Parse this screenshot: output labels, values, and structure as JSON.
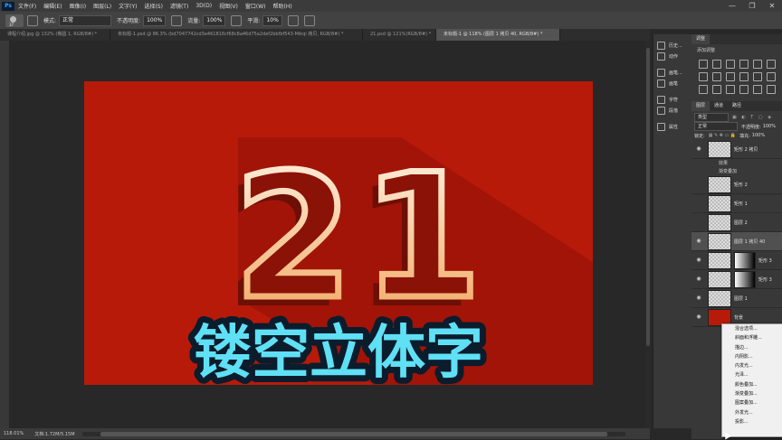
{
  "menubar": {
    "app_icon": "Ps",
    "items": [
      "文件(F)",
      "编辑(E)",
      "图像(I)",
      "图层(L)",
      "文字(Y)",
      "选择(S)",
      "滤镜(T)",
      "3D(D)",
      "视图(V)",
      "窗口(W)",
      "帮助(H)"
    ],
    "window_controls": [
      "—",
      "❐",
      "✕"
    ]
  },
  "options": {
    "brush_size": "37",
    "mode_label": "模式:",
    "mode_value": "正常",
    "opacity_label": "不透明度:",
    "opacity_value": "100%",
    "flow_label": "流量:",
    "flow_value": "100%",
    "smooth_label": "平滑:",
    "smooth_value": "10%"
  },
  "tabs": [
    {
      "label": "课程介绍.jpg @ 132% (椭圆 1, RGB/8#) *"
    },
    {
      "label": "未标题-1.psd @ 86.3% (bd7047742cd3e461816cf68c8a46d75a2def2bbfbf543-Mikqi 拷贝, RGB/8#) *"
    },
    {
      "label": "21.psd @ 121%(RGB/8#) *"
    },
    {
      "label": "未标题-1 @ 118% (图层 1 拷贝 40, RGB/8#) *"
    }
  ],
  "status": {
    "zoom": "118.01%",
    "doc": "文档:1.72M/5.15M"
  },
  "mid_panel": {
    "group1": [
      "历史...",
      "动作"
    ],
    "group2": [
      "画笔...",
      "画笔"
    ],
    "group3": [
      "字符",
      "段落"
    ],
    "group4": [
      "属性"
    ]
  },
  "adjustments": {
    "title": "调整",
    "add_label": "添加调整"
  },
  "layers_panel": {
    "tabs": [
      "图层",
      "通道",
      "路径"
    ],
    "filter_label": "类型",
    "blend_mode": "正常",
    "opacity_label": "不透明度:",
    "opacity_value": "100%",
    "lock_label": "锁定:",
    "fill_label": "填充:",
    "fill_value": "100%",
    "layers": [
      {
        "name": "矩形 2 拷贝",
        "visible": true
      },
      {
        "name": "效果",
        "type": "sub"
      },
      {
        "name": "渐变叠加",
        "type": "sub"
      },
      {
        "name": "矩形 2",
        "visible": false
      },
      {
        "name": "矩形 1",
        "visible": false
      },
      {
        "name": "图层 2",
        "visible": false
      },
      {
        "name": "图层 1 拷贝 40",
        "visible": true
      },
      {
        "name": "矩形 3",
        "visible": true
      },
      {
        "name": "矩形 3",
        "visible": true
      },
      {
        "name": "图层 1",
        "visible": true
      },
      {
        "name": "背景",
        "visible": true
      }
    ]
  },
  "context_menu": {
    "items": [
      "混合选项...",
      "斜面和浮雕...",
      "描边...",
      "内阴影...",
      "内发光...",
      "光泽...",
      "颜色叠加...",
      "渐变叠加...",
      "图案叠加...",
      "外发光...",
      "投影..."
    ]
  },
  "artwork": {
    "number_text": "21",
    "title_text": "镂空立体字",
    "bg_color": "#b81a0a",
    "title_fill": "#5fe0f5",
    "outline_gradient_top": "#fff4e6",
    "outline_gradient_bottom": "#f0a45a"
  }
}
